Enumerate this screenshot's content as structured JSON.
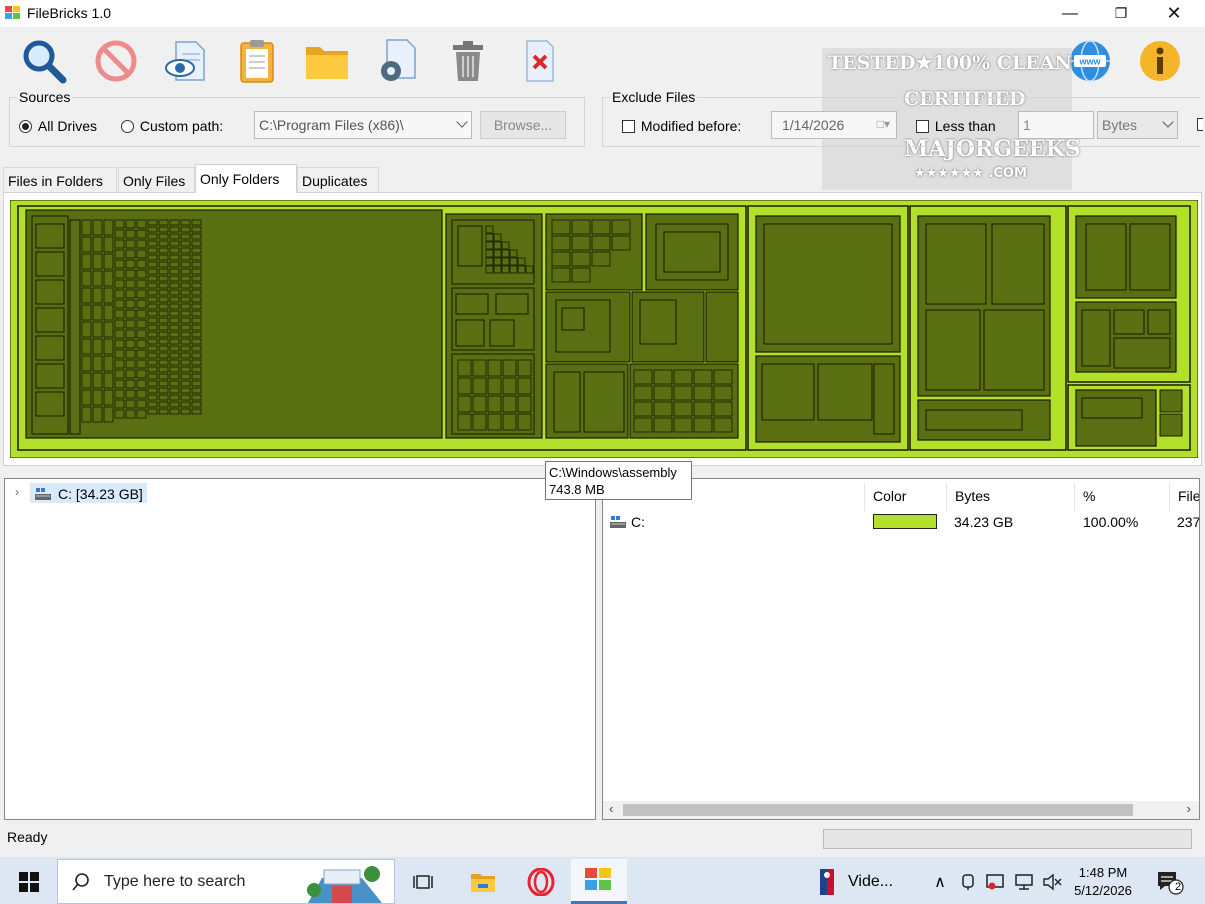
{
  "window": {
    "title": "FileBricks 1.0",
    "minimize_icon": "minimize-icon",
    "maximize_icon": "maximize-icon",
    "close_icon": "close-icon"
  },
  "toolbar": {
    "buttons": [
      "search-icon",
      "stop-icon",
      "preview-icon",
      "clipboard-icon",
      "folder-icon",
      "settings-icon",
      "trash-icon",
      "delete-file-icon"
    ],
    "right_buttons": [
      "web-icon",
      "info-icon"
    ]
  },
  "watermark": {
    "line1": "TESTED★100% CLEAN",
    "line2": "CERTIFIED",
    "line3": "MAJORGEEKS",
    "line4": "★★★★★★ .COM"
  },
  "sources": {
    "legend": "Sources",
    "all_drives_label": "All Drives",
    "custom_path_label": "Custom path:",
    "custom_path_value": "C:\\Program Files (x86)\\",
    "browse_label": "Browse...",
    "selected": "all_drives"
  },
  "exclude": {
    "legend": "Exclude Files",
    "modified_before_label": "Modified before:",
    "modified_before_value": "1/14/2026",
    "less_than_label": "Less than",
    "less_than_value": "1",
    "unit_value": "Bytes"
  },
  "tabs": [
    "Files in Folders",
    "Only Files",
    "Only Folders",
    "Duplicates"
  ],
  "active_tab": "Only Folders",
  "tooltip": {
    "path": "C:\\Windows\\assembly",
    "size": "743.8 MB"
  },
  "tree": {
    "root_label": "C:  [34.23 GB]"
  },
  "list": {
    "columns": [
      "Color",
      "Bytes",
      "%",
      "File"
    ],
    "rows": [
      {
        "name": "C:",
        "color": "#b3e02a",
        "bytes": "34.23 GB",
        "percent": "100.00%",
        "files": "237"
      }
    ]
  },
  "status": {
    "text": "Ready"
  },
  "taskbar": {
    "search_placeholder": "Type here to search",
    "pinned_label": "Vide...",
    "time": "1:48 PM",
    "date": "5/12/2026",
    "notification_count": "2"
  },
  "colors": {
    "treemap_bright": "#b3e02a",
    "treemap_dark": "#5a6e12"
  }
}
